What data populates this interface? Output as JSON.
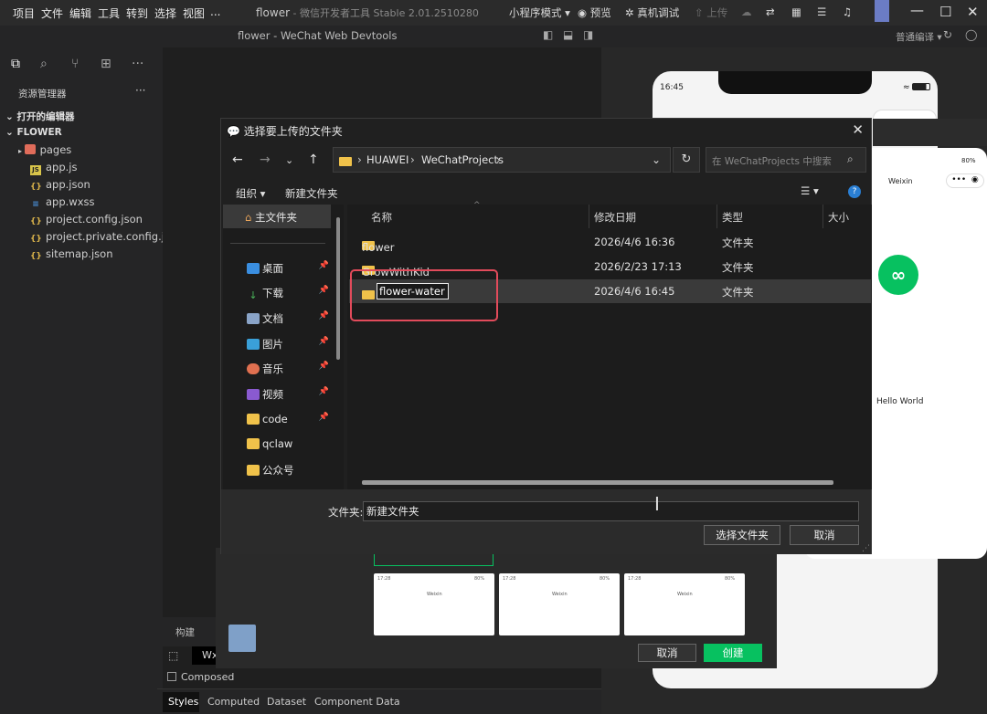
{
  "menubar": {
    "items": [
      "项目",
      "文件",
      "编辑",
      "工具",
      "转到",
      "选择",
      "视图",
      "..."
    ]
  },
  "window": {
    "title_app": "flower",
    "title_rest": "微信开发者工具 Stable 2.01.2510280",
    "subtitle": "flower - WeChat Web Devtools"
  },
  "toolbar": {
    "mode": "小程序模式",
    "preview": "预览",
    "device_debug": "真机调试",
    "upload": "上传",
    "compile_mode": "普通编译"
  },
  "explorer": {
    "title": "资源管理器",
    "open_editors": "打开的编辑器",
    "project": "FLOWER",
    "files": [
      {
        "name": "pages",
        "icon": "folder-icon"
      },
      {
        "name": "app.js",
        "icon": "js-file-icon"
      },
      {
        "name": "app.json",
        "icon": "json-file-icon"
      },
      {
        "name": "app.wxss",
        "icon": "wxss-file-icon"
      },
      {
        "name": "project.config.json",
        "icon": "json-file-icon"
      },
      {
        "name": "project.private.config.js...",
        "icon": "json-file-icon"
      },
      {
        "name": "sitemap.json",
        "icon": "json-file-icon"
      }
    ]
  },
  "dialog": {
    "title": "选择要上传的文件夹",
    "breadcrumb": [
      "HUAWEI",
      "WeChatProjects"
    ],
    "search_placeholder": "在 WeChatProjects 中搜索",
    "organize": "组织",
    "new_folder": "新建文件夹",
    "nav": [
      {
        "label": "主文件夹",
        "pinned": false
      },
      {
        "label": "桌面",
        "pinned": true
      },
      {
        "label": "下载",
        "pinned": true
      },
      {
        "label": "文档",
        "pinned": true
      },
      {
        "label": "图片",
        "pinned": true
      },
      {
        "label": "音乐",
        "pinned": true
      },
      {
        "label": "视频",
        "pinned": true
      },
      {
        "label": "code",
        "pinned": true
      },
      {
        "label": "qclaw",
        "pinned": false
      },
      {
        "label": "公众号",
        "pinned": false
      }
    ],
    "columns": {
      "name": "名称",
      "date": "修改日期",
      "type": "类型",
      "size": "大小"
    },
    "rows": [
      {
        "name": "flower",
        "date": "2026/4/6 16:36",
        "type": "文件夹"
      },
      {
        "name": "GrowWithKid",
        "date": "2026/2/23 17:13",
        "type": "文件夹"
      },
      {
        "name": "flower-water",
        "date": "2026/4/6 16:45",
        "type": "文件夹"
      }
    ],
    "folder_label": "文件夹:",
    "folder_value": "新建文件夹",
    "select_button": "选择文件夹",
    "cancel_button": "取消"
  },
  "simulator": {
    "time": "16:45",
    "battery": "80%",
    "nav_title": "Weixin",
    "content": "Hello World"
  },
  "bottom": {
    "tab_build": "构建",
    "wx_tab": "Wx",
    "composed": "Composed",
    "tabs": [
      "Styles",
      "Computed",
      "Dataset",
      "Component Data"
    ],
    "cancel": "取消",
    "create": "创建",
    "thumb_time": "17:28",
    "thumb_battery": "80%",
    "thumb_title": "Weixin"
  }
}
